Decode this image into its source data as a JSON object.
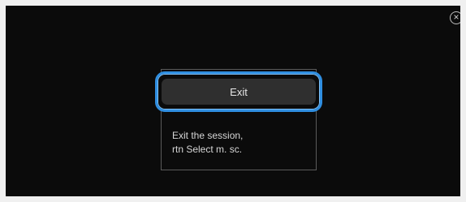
{
  "header": {
    "close_icon": "close-circle-icon",
    "close_glyph": "×"
  },
  "dialog": {
    "button_label": "Exit",
    "description_lines": [
      "Exit the session,",
      "rtn Select m. sc."
    ]
  },
  "colors": {
    "background": "#0b0b0b",
    "selection_outline": "#2f8ee0",
    "button_fill": "#2f2f2f",
    "text": "#e6e6e6"
  }
}
